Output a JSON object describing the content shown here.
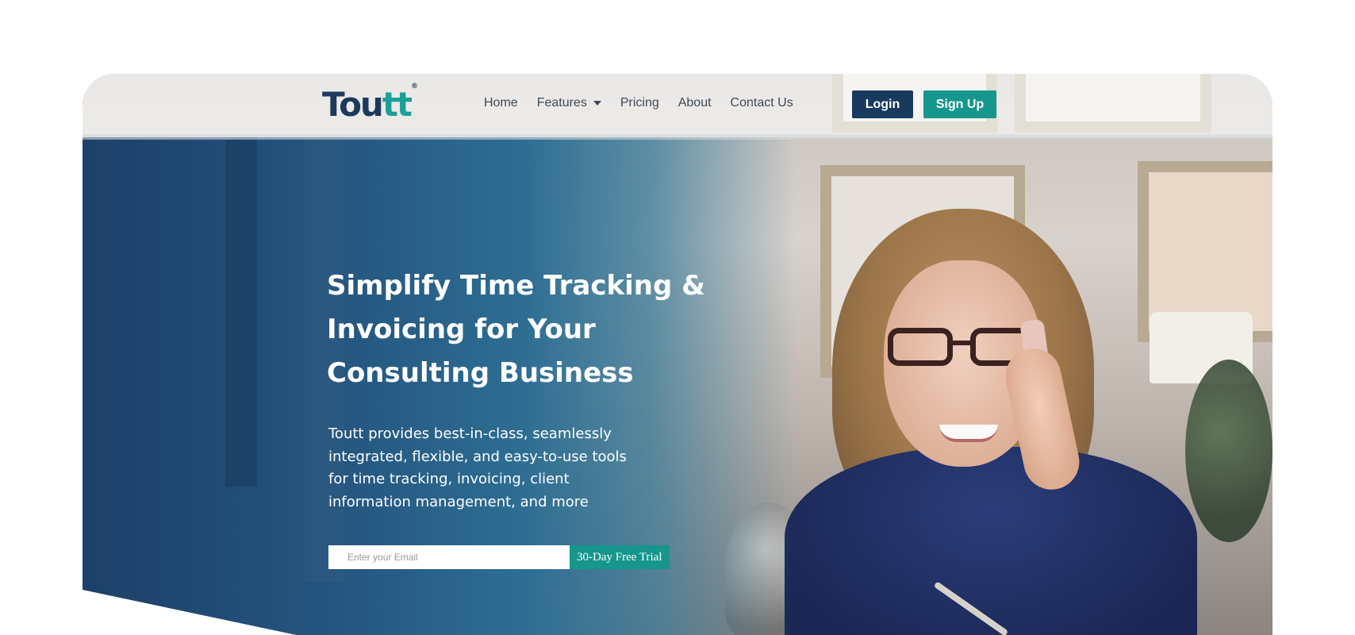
{
  "brand": {
    "logo_main": "Tou",
    "logo_accent": "tt",
    "logo_mark": "®"
  },
  "nav": {
    "links": [
      "Home",
      "Features",
      "Pricing",
      "About",
      "Contact Us"
    ],
    "login_label": "Login",
    "signup_label": "Sign Up"
  },
  "hero": {
    "headline": "Simplify Time Tracking & Invoicing for Your Consulting Business",
    "subtext": "Toutt provides best-in-class, seamlessly integrated, flexible, and easy-to-use tools for time tracking, invoicing, client information management, and more",
    "email_placeholder": "Enter your Email",
    "cta_label": "30-Day Free Trial"
  },
  "colors": {
    "navy": "#183a5f",
    "teal": "#16968c",
    "hero_blue": "#24557f"
  },
  "icons": {
    "features_dropdown": "chevron-down-icon"
  }
}
